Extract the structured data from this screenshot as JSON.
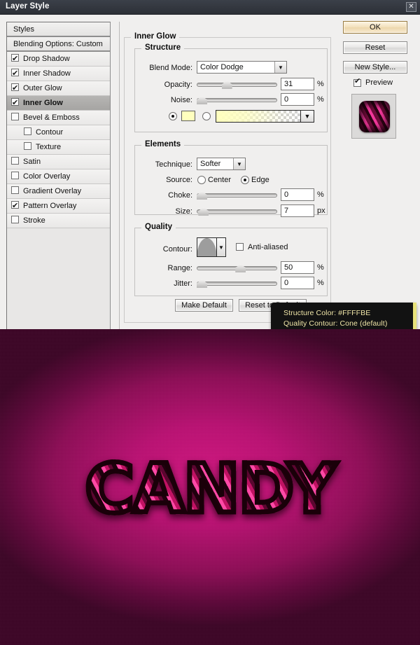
{
  "window": {
    "title": "Layer Style",
    "close_label": "✕"
  },
  "styles_panel": {
    "header": "Styles",
    "blending_options": "Blending Options: Custom",
    "items": [
      {
        "label": "Drop Shadow",
        "checked": true,
        "sub": false,
        "active": false
      },
      {
        "label": "Inner Shadow",
        "checked": true,
        "sub": false,
        "active": false
      },
      {
        "label": "Outer Glow",
        "checked": true,
        "sub": false,
        "active": false
      },
      {
        "label": "Inner Glow",
        "checked": true,
        "sub": false,
        "active": true
      },
      {
        "label": "Bevel & Emboss",
        "checked": false,
        "sub": false,
        "active": false
      },
      {
        "label": "Contour",
        "checked": false,
        "sub": true,
        "active": false
      },
      {
        "label": "Texture",
        "checked": false,
        "sub": true,
        "active": false
      },
      {
        "label": "Satin",
        "checked": false,
        "sub": false,
        "active": false
      },
      {
        "label": "Color Overlay",
        "checked": false,
        "sub": false,
        "active": false
      },
      {
        "label": "Gradient Overlay",
        "checked": false,
        "sub": false,
        "active": false
      },
      {
        "label": "Pattern Overlay",
        "checked": true,
        "sub": false,
        "active": false
      },
      {
        "label": "Stroke",
        "checked": false,
        "sub": false,
        "active": false
      }
    ]
  },
  "panel": {
    "title": "Inner Glow",
    "structure": {
      "legend": "Structure",
      "blend_mode_label": "Blend Mode:",
      "blend_mode_value": "Color Dodge",
      "opacity_label": "Opacity:",
      "opacity_value": "31",
      "opacity_unit": "%",
      "noise_label": "Noise:",
      "noise_value": "0",
      "noise_unit": "%",
      "fill_type": "color",
      "color_hex": "#FFFFBE"
    },
    "elements": {
      "legend": "Elements",
      "technique_label": "Technique:",
      "technique_value": "Softer",
      "source_label": "Source:",
      "source_center_label": "Center",
      "source_edge_label": "Edge",
      "source_selected": "Edge",
      "choke_label": "Choke:",
      "choke_value": "0",
      "choke_unit": "%",
      "size_label": "Size:",
      "size_value": "7",
      "size_unit": "px"
    },
    "quality": {
      "legend": "Quality",
      "contour_label": "Contour:",
      "contour_name": "Cone (default)",
      "anti_aliased_label": "Anti-aliased",
      "anti_aliased_checked": false,
      "range_label": "Range:",
      "range_value": "50",
      "range_unit": "%",
      "jitter_label": "Jitter:",
      "jitter_value": "0",
      "jitter_unit": "%"
    },
    "make_default_label": "Make Default",
    "reset_to_default_label": "Reset to Default"
  },
  "buttons": {
    "ok": "OK",
    "reset": "Reset",
    "new_style": "New Style...",
    "preview_label": "Preview",
    "preview_checked": true
  },
  "tooltip": {
    "line1": "Structure Color: #FFFFBE",
    "line2": "Quality Contour: Cone (default)"
  },
  "artwork": {
    "text": "CANDY"
  }
}
